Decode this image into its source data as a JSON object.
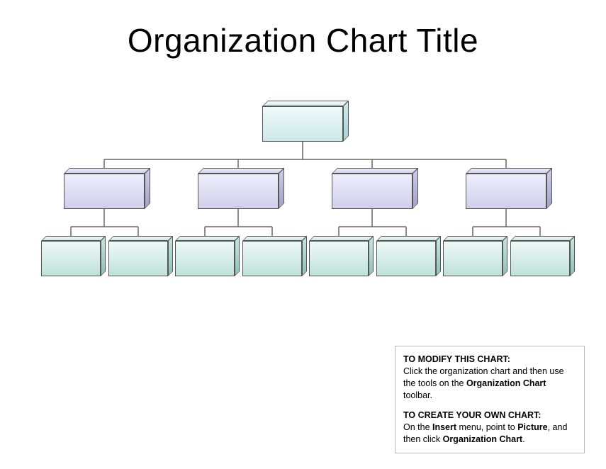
{
  "title": "Organization Chart Title",
  "chart": {
    "root": {
      "label": ""
    },
    "managers": [
      {
        "label": ""
      },
      {
        "label": ""
      },
      {
        "label": ""
      },
      {
        "label": ""
      }
    ],
    "reports": [
      [
        {
          "label": ""
        },
        {
          "label": ""
        }
      ],
      [
        {
          "label": ""
        },
        {
          "label": ""
        }
      ],
      [
        {
          "label": ""
        },
        {
          "label": ""
        }
      ],
      [
        {
          "label": ""
        },
        {
          "label": ""
        }
      ]
    ],
    "colors": {
      "root_light": "#e8f4f4",
      "root_dark": "#c8e6e6",
      "mgr_light": "#e4e4f6",
      "mgr_dark": "#b8b8dc",
      "rep_light": "#e2f2ef",
      "rep_dark": "#9cccc5",
      "edge": "#555555"
    }
  },
  "note": {
    "h1": "TO MODIFY THIS CHART:",
    "p1a": "Click the organization chart and then use the tools on the ",
    "p1b": "Organization Chart",
    "p1c": " toolbar.",
    "h2": "TO CREATE YOUR OWN CHART:",
    "p2a": "On the ",
    "p2b": "Insert",
    "p2c": " menu, point to ",
    "p2d": "Picture",
    "p2e": ", and then click ",
    "p2f": "Organization Chart",
    "p2g": "."
  }
}
